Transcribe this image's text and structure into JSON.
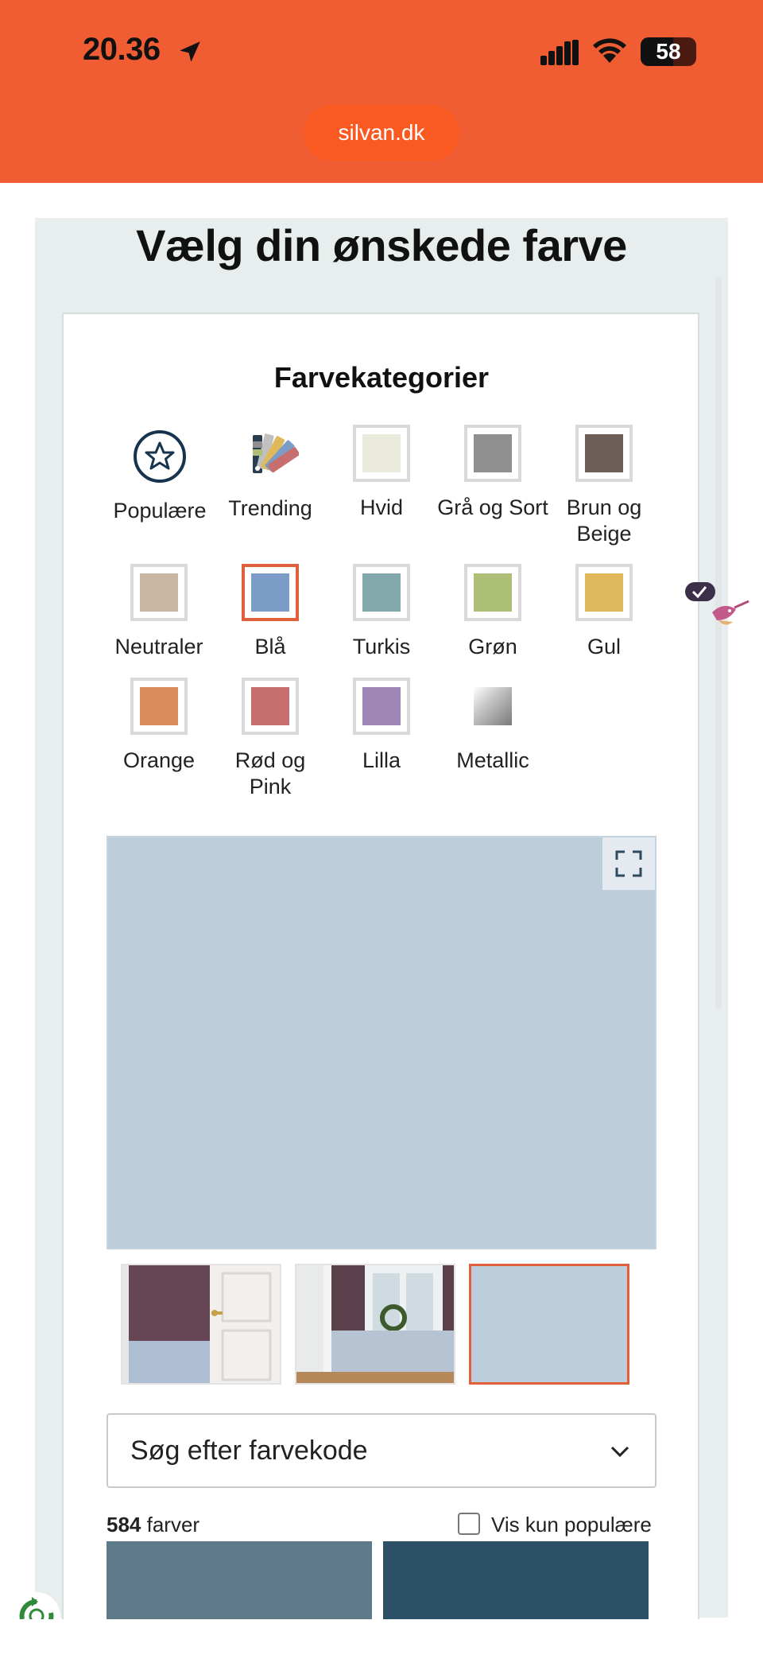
{
  "status_bar": {
    "time": "20.36",
    "battery": "58",
    "battery_level": 0.58
  },
  "browser": {
    "url": "silvan.dk"
  },
  "page": {
    "title": "Vælg din ønskede farve",
    "categories_title": "Farvekategorier"
  },
  "categories": [
    {
      "label": "Populære",
      "type": "star-icon"
    },
    {
      "label": "Trending",
      "type": "fan-deck-icon"
    },
    {
      "label": "Hvid",
      "color": "#ebebdd"
    },
    {
      "label": "Grå og Sort",
      "color": "#8f8f8f"
    },
    {
      "label": "Brun og Beige",
      "color": "#6b5f58"
    },
    {
      "label": "Neutraler",
      "color": "#c8b5a2"
    },
    {
      "label": "Blå",
      "color": "#7a9cc7",
      "selected": true
    },
    {
      "label": "Turkis",
      "color": "#83a8ab"
    },
    {
      "label": "Grøn",
      "color": "#adbf77"
    },
    {
      "label": "Gul",
      "color": "#e0b95c"
    },
    {
      "label": "Orange",
      "color": "#da8a5b"
    },
    {
      "label": "Rød og Pink",
      "color": "#c76e6e"
    },
    {
      "label": "Lilla",
      "color": "#9f86b5"
    },
    {
      "label": "Metallic",
      "type": "metallic-gradient"
    }
  ],
  "preview": {
    "color": "#bccddc"
  },
  "thumbnails": [
    {
      "label": "room-door-scene"
    },
    {
      "label": "room-window-scene"
    },
    {
      "label": "plain-swatch",
      "color": "#bccddc",
      "selected": true
    }
  ],
  "search": {
    "placeholder": "Søg efter farvekode"
  },
  "results": {
    "count": "584",
    "count_suffix": " farver",
    "popular_toggle": "Vis kun populære",
    "tiles": [
      {
        "color": "#5d798a"
      },
      {
        "color": "#2c5166"
      }
    ]
  }
}
